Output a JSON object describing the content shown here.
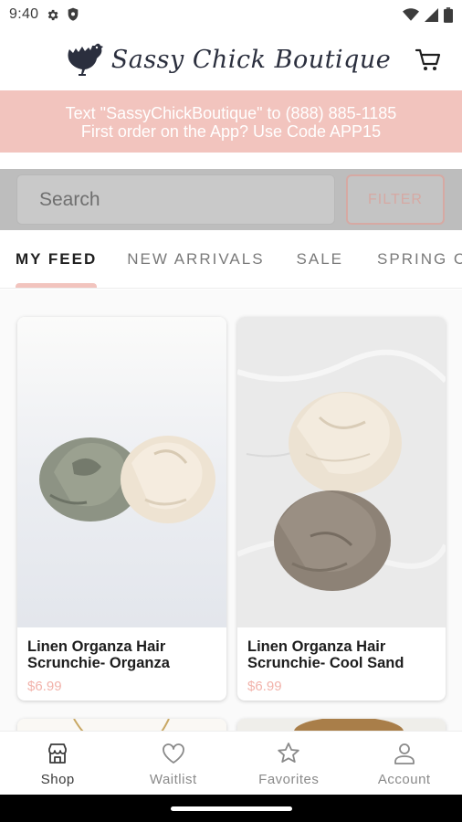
{
  "status_bar": {
    "time": "9:40",
    "left_icons": [
      "settings-gear-icon",
      "shield-icon"
    ],
    "right_icons": [
      "wifi-icon",
      "signal-icon",
      "battery-icon"
    ]
  },
  "header": {
    "brand_name": "Sassy Chick Boutique",
    "logo_icon": "chicken-logo-icon",
    "cart_icon": "cart-icon"
  },
  "promo": {
    "line1": "Text \"SassyChickBoutique\" to (888) 885-1185",
    "line2": "First order on the App? Use Code APP15",
    "background": "#f2c4be"
  },
  "search": {
    "placeholder": "Search",
    "filter_label": "FILTER"
  },
  "tabs": [
    {
      "label": "MY FEED",
      "active": true
    },
    {
      "label": "NEW ARRIVALS",
      "active": false
    },
    {
      "label": "SALE",
      "active": false
    },
    {
      "label": "SPRING CLE",
      "active": false
    }
  ],
  "products": [
    {
      "title": "Linen Organza Hair Scrunchie- Organza",
      "price": "$6.99"
    },
    {
      "title": "Linen Organza Hair Scrunchie- Cool Sand",
      "price": "$6.99"
    }
  ],
  "bottom_nav": [
    {
      "label": "Shop",
      "icon": "store-icon",
      "active": true
    },
    {
      "label": "Waitlist",
      "icon": "heart-icon",
      "active": false
    },
    {
      "label": "Favorites",
      "icon": "star-icon",
      "active": false
    },
    {
      "label": "Account",
      "icon": "person-icon",
      "active": false
    }
  ],
  "colors": {
    "accent_pink": "#f2c4be",
    "price_pink": "#f2b3ab",
    "brand_navy": "#2b2f3e"
  }
}
